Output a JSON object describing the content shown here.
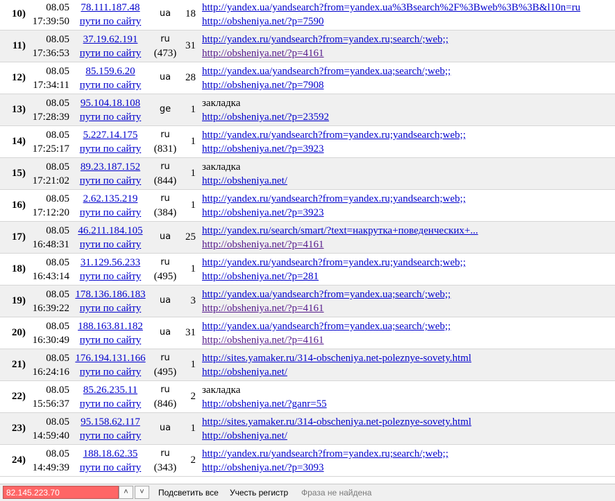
{
  "rows": [
    {
      "num": "10)",
      "date": "08.05",
      "time": "17:39:50",
      "ip": "78.111.187.48",
      "paths": "пути по сайту",
      "cc": "ua",
      "sub": "",
      "count": "18",
      "referrer": "http://yandex.ua/yandsearch?from=yandex.ua%3Bsearch%2F%3Bweb%3B%3B&l10n=ru",
      "referrer_link": true,
      "landing": "http://obsheniya.net/?p=7590",
      "landing_visited": false
    },
    {
      "num": "11)",
      "date": "08.05",
      "time": "17:36:53",
      "ip": "37.19.62.191",
      "paths": "пути по сайту",
      "cc": "ru",
      "sub": "(473)",
      "count": "31",
      "referrer": "http://yandex.ru/yandsearch?from=yandex.ru;search/;web;;",
      "referrer_link": true,
      "landing": "http://obsheniya.net/?p=4161",
      "landing_visited": true
    },
    {
      "num": "12)",
      "date": "08.05",
      "time": "17:34:11",
      "ip": "85.159.6.20",
      "paths": "пути по сайту",
      "cc": "ua",
      "sub": "",
      "count": "28",
      "referrer": "http://yandex.ua/yandsearch?from=yandex.ua;search/;web;;",
      "referrer_link": true,
      "landing": "http://obsheniya.net/?p=7908",
      "landing_visited": false
    },
    {
      "num": "13)",
      "date": "08.05",
      "time": "17:28:39",
      "ip": "95.104.18.108",
      "paths": "пути по сайту",
      "cc": "ge",
      "sub": "",
      "count": "1",
      "referrer": "закладка",
      "referrer_link": false,
      "landing": "http://obsheniya.net/?p=23592",
      "landing_visited": false
    },
    {
      "num": "14)",
      "date": "08.05",
      "time": "17:25:17",
      "ip": "5.227.14.175",
      "paths": "пути по сайту",
      "cc": "ru",
      "sub": "(831)",
      "count": "1",
      "referrer": "http://yandex.ru/yandsearch?from=yandex.ru;yandsearch;web;;",
      "referrer_link": true,
      "landing": "http://obsheniya.net/?p=3923",
      "landing_visited": false
    },
    {
      "num": "15)",
      "date": "08.05",
      "time": "17:21:02",
      "ip": "89.23.187.152",
      "paths": "пути по сайту",
      "cc": "ru",
      "sub": "(844)",
      "count": "1",
      "referrer": "закладка",
      "referrer_link": false,
      "landing": "http://obsheniya.net/",
      "landing_visited": false
    },
    {
      "num": "16)",
      "date": "08.05",
      "time": "17:12:20",
      "ip": "2.62.135.219",
      "paths": "пути по сайту",
      "cc": "ru",
      "sub": "(384)",
      "count": "1",
      "referrer": "http://yandex.ru/yandsearch?from=yandex.ru;yandsearch;web;;",
      "referrer_link": true,
      "landing": "http://obsheniya.net/?p=3923",
      "landing_visited": false
    },
    {
      "num": "17)",
      "date": "08.05",
      "time": "16:48:31",
      "ip": "46.211.184.105",
      "paths": "пути по сайту",
      "cc": "ua",
      "sub": "",
      "count": "25",
      "referrer": "http://yandex.ru/search/smart/?text=накрутка+поведенческих+...",
      "referrer_link": true,
      "landing": "http://obsheniya.net/?p=4161",
      "landing_visited": true
    },
    {
      "num": "18)",
      "date": "08.05",
      "time": "16:43:14",
      "ip": "31.129.56.233",
      "paths": "пути по сайту",
      "cc": "ru",
      "sub": "(495)",
      "count": "1",
      "referrer": "http://yandex.ru/yandsearch?from=yandex.ru;yandsearch;web;;",
      "referrer_link": true,
      "landing": "http://obsheniya.net/?p=281",
      "landing_visited": false
    },
    {
      "num": "19)",
      "date": "08.05",
      "time": "16:39:22",
      "ip": "178.136.186.183",
      "paths": "пути по сайту",
      "cc": "ua",
      "sub": "",
      "count": "3",
      "referrer": "http://yandex.ua/yandsearch?from=yandex.ua;search/;web;;",
      "referrer_link": true,
      "landing": "http://obsheniya.net/?p=4161",
      "landing_visited": true
    },
    {
      "num": "20)",
      "date": "08.05",
      "time": "16:30:49",
      "ip": "188.163.81.182",
      "paths": "пути по сайту",
      "cc": "ua",
      "sub": "",
      "count": "31",
      "referrer": "http://yandex.ua/yandsearch?from=yandex.ua;search/;web;;",
      "referrer_link": true,
      "landing": "http://obsheniya.net/?p=4161",
      "landing_visited": true
    },
    {
      "num": "21)",
      "date": "08.05",
      "time": "16:24:16",
      "ip": "176.194.131.166",
      "paths": "пути по сайту",
      "cc": "ru",
      "sub": "(495)",
      "count": "1",
      "referrer": "http://sites.yamaker.ru/314-obscheniya.net-poleznye-sovety.html",
      "referrer_link": true,
      "landing": "http://obsheniya.net/",
      "landing_visited": false
    },
    {
      "num": "22)",
      "date": "08.05",
      "time": "15:56:37",
      "ip": "85.26.235.11",
      "paths": "пути по сайту",
      "cc": "ru",
      "sub": "(846)",
      "count": "2",
      "referrer": "закладка",
      "referrer_link": false,
      "landing": "http://obsheniya.net/?ganr=55",
      "landing_visited": false
    },
    {
      "num": "23)",
      "date": "08.05",
      "time": "14:59:40",
      "ip": "95.158.62.117",
      "paths": "пути по сайту",
      "cc": "ua",
      "sub": "",
      "count": "1",
      "referrer": "http://sites.yamaker.ru/314-obscheniya.net-poleznye-sovety.html",
      "referrer_link": true,
      "landing": "http://obsheniya.net/",
      "landing_visited": false
    },
    {
      "num": "24)",
      "date": "08.05",
      "time": "14:49:39",
      "ip": "188.18.62.35",
      "paths": "пути по сайту",
      "cc": "ru",
      "sub": "(343)",
      "count": "2",
      "referrer": "http://yandex.ru/yandsearch?from=yandex.ru;search/;web;;",
      "referrer_link": true,
      "landing": "http://obsheniya.net/?p=3093",
      "landing_visited": false
    }
  ],
  "findbar": {
    "query": "82.145.223.70",
    "prev_icon": "chevron-up-icon",
    "next_icon": "chevron-down-icon",
    "highlight_all": "Подсветить все",
    "match_case": "Учесть регистр",
    "status": "Фраза не найдена",
    "query_bg": "#ff6666"
  }
}
